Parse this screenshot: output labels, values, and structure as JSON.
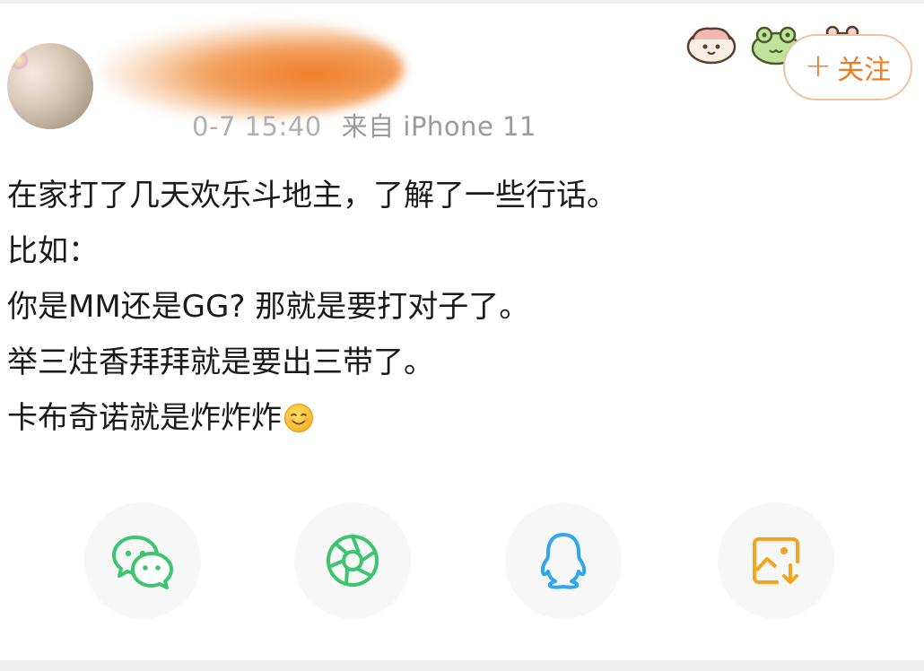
{
  "post": {
    "meta_time": "0-7 15:40",
    "meta_source": "来自 iPhone 11",
    "follow_plus": "+",
    "follow_label": "关注",
    "content_lines": [
      "在家打了几天欢乐斗地主，了解了一些行话。",
      "比如：",
      "你是MM还是GG? 那就是要打对子了。",
      "举三炷香拜拜就是要出三带了。",
      "卡布奇诺就是炸炸炸"
    ],
    "content_trailing_emoji": "smiling-face-icon"
  },
  "share": {
    "items": [
      {
        "icon": "wechat-icon",
        "color": "#3cc46f"
      },
      {
        "icon": "moments-shutter-icon",
        "color": "#3cc46f"
      },
      {
        "icon": "qq-penguin-icon",
        "color": "#2fa6ee"
      },
      {
        "icon": "save-image-icon",
        "color": "#f3a51e"
      }
    ]
  },
  "colors": {
    "accent_orange": "#f07a22",
    "follow_border": "#f0c39e",
    "meta_gray": "#9a9a9a",
    "text": "#1a1a1a"
  }
}
